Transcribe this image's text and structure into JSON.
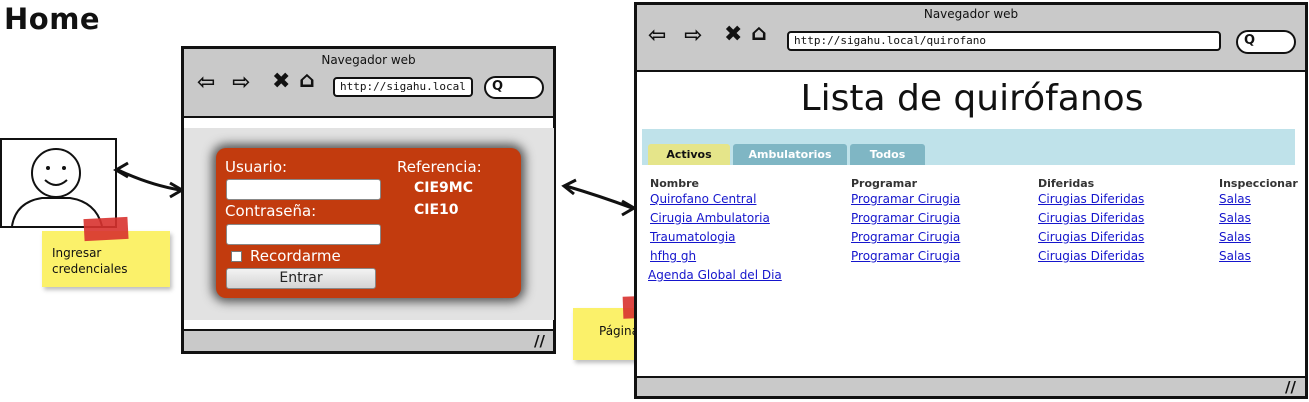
{
  "page_title": "Home",
  "login_window": {
    "title": "Navegador web",
    "url": "http://sigahu.local",
    "form": {
      "user_label": "Usuario:",
      "password_label": "Contraseña:",
      "remember_label": "Recordarme",
      "submit_label": "Entrar",
      "reference_label": "Referencia:",
      "references": [
        "CIE9MC",
        "CIE10"
      ]
    }
  },
  "list_window": {
    "title": "Navegador web",
    "url": "http://sigahu.local/quirofano",
    "heading": "Lista de quirófanos",
    "tabs": [
      "Activos",
      "Ambulatorios",
      "Todos"
    ],
    "columns": [
      "Nombre",
      "Programar",
      "Diferidas",
      "Inspeccionar"
    ],
    "rows": [
      {
        "name": "Quirofano Central",
        "program": "Programar Cirugia",
        "deferred": "Cirugias Diferidas",
        "inspect": "Salas"
      },
      {
        "name": "Cirugia Ambulatoria",
        "program": "Programar Cirugia",
        "deferred": "Cirugias Diferidas",
        "inspect": "Salas"
      },
      {
        "name": "Traumatologia",
        "program": "Programar Cirugia",
        "deferred": "Cirugias Diferidas",
        "inspect": "Salas"
      },
      {
        "name": "hfhg gh",
        "program": "Programar Cirugia",
        "deferred": "Cirugias Diferidas",
        "inspect": "Salas"
      }
    ],
    "footer_link": "Agenda Global del Dia"
  },
  "notes": {
    "credentials": "Ingresar credenciales",
    "start_page": "Página de inicio"
  },
  "colors": {
    "login_box": "#c23b0e",
    "sticky": "#fbf16a",
    "tape": "#d8322f",
    "tab_active": "#e5e58a",
    "tab_inactive": "#7fb6c4",
    "tabbar": "#bfe2ea",
    "link": "#1515cc"
  },
  "icons": [
    "back-arrow-icon",
    "forward-arrow-icon",
    "close-icon",
    "home-icon",
    "search-icon",
    "resize-grip-icon",
    "user-face-icon"
  ]
}
